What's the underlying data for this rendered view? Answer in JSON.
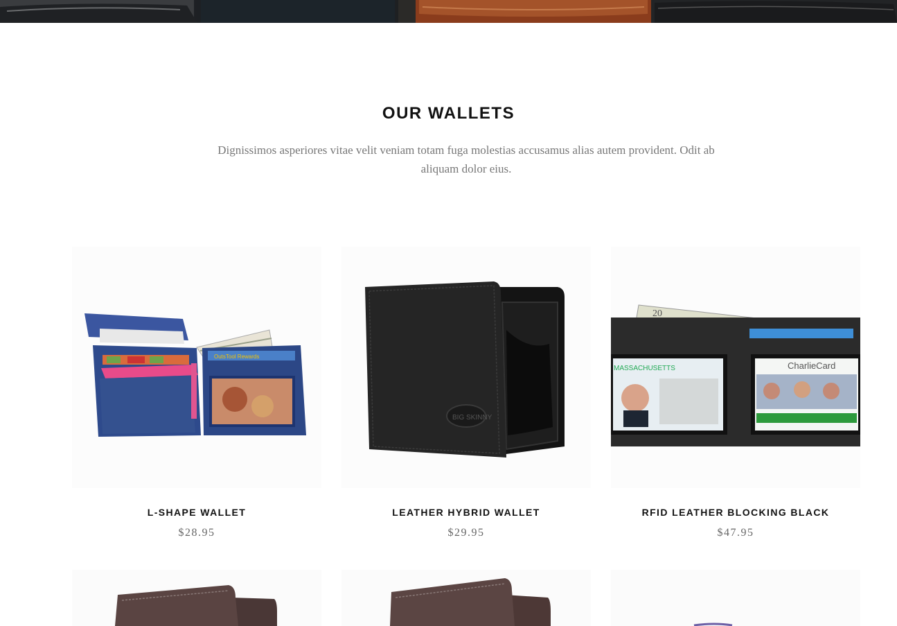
{
  "section": {
    "title": "OUR WALLETS",
    "description": "Dignissimos asperiores vitae velit veniam totam fuga molestias accusamus alias autem provident. Odit ab aliquam dolor eius."
  },
  "products": [
    {
      "name": "L-SHAPE WALLET",
      "price": "$28.95",
      "image": "navy-l-shape-wallet"
    },
    {
      "name": "LEATHER HYBRID WALLET",
      "price": "$29.95",
      "image": "black-leather-hybrid-wallet"
    },
    {
      "name": "RFID LEATHER BLOCKING BLACK",
      "price": "$47.95",
      "image": "black-rfid-wallet-with-id"
    }
  ],
  "colors": {
    "heading": "#111111",
    "body_text": "#777777",
    "price": "#666666"
  }
}
